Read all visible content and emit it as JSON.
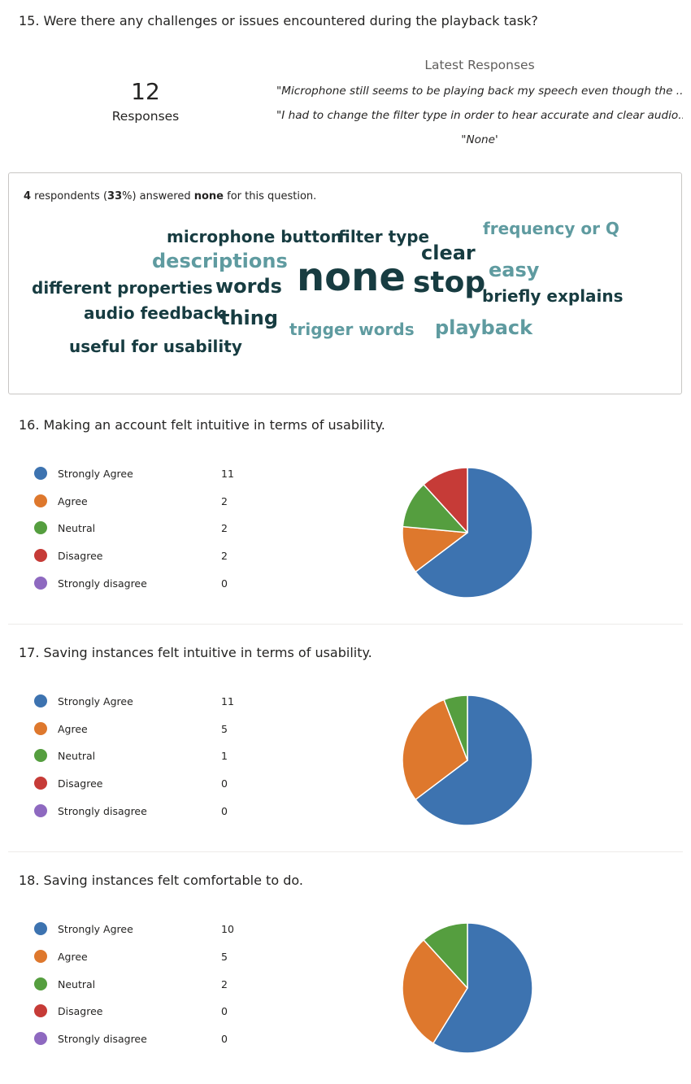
{
  "q15": {
    "title": "15.  Were there any challenges or issues encountered during the playback task?",
    "responses_count": "12",
    "responses_label": "Responses",
    "latest_title": "Latest Responses",
    "latest": [
      "\"Microphone still seems to be playing back my speech even though the ...",
      "\"I had to change the filter type in order to hear accurate and clear audio...",
      "\"None'"
    ],
    "summary": {
      "count": "4",
      "text1": " respondents (",
      "pct": "33",
      "text2": "%) answered ",
      "keyword": "none",
      "text3": " for this question."
    },
    "words": [
      {
        "text": "microphone button",
        "tone": "dark"
      },
      {
        "text": "filter type",
        "tone": "dark"
      },
      {
        "text": "frequency or Q",
        "tone": "light"
      },
      {
        "text": "clear",
        "tone": "dark"
      },
      {
        "text": "descriptions",
        "tone": "light"
      },
      {
        "text": "easy",
        "tone": "light"
      },
      {
        "text": "different properties",
        "tone": "dark"
      },
      {
        "text": "words",
        "tone": "dark"
      },
      {
        "text": "none",
        "tone": "dark"
      },
      {
        "text": "stop",
        "tone": "dark"
      },
      {
        "text": "briefly explains",
        "tone": "dark"
      },
      {
        "text": "audio feedback",
        "tone": "dark"
      },
      {
        "text": "thing",
        "tone": "dark"
      },
      {
        "text": "trigger words",
        "tone": "light"
      },
      {
        "text": "playback",
        "tone": "light"
      },
      {
        "text": "useful for usability",
        "tone": "dark"
      }
    ]
  },
  "colors": {
    "Strongly Agree": "#3d73b0",
    "Agree": "#de782d",
    "Neutral": "#559e3f",
    "Disagree": "#c63b37",
    "Strongly disagree": "#8e69c0",
    "word_dark": "#173c41",
    "word_light": "#5f9ba0"
  },
  "q16": {
    "title": "16.  Making an account felt intuitive in terms of usability.",
    "options": [
      {
        "label": "Strongly Agree",
        "value": "11"
      },
      {
        "label": "Agree",
        "value": "2"
      },
      {
        "label": "Neutral",
        "value": "2"
      },
      {
        "label": "Disagree",
        "value": "2"
      },
      {
        "label": "Strongly disagree",
        "value": "0"
      }
    ]
  },
  "q17": {
    "title": "17.  Saving instances felt intuitive in terms of usability.",
    "options": [
      {
        "label": "Strongly Agree",
        "value": "11"
      },
      {
        "label": "Agree",
        "value": "5"
      },
      {
        "label": "Neutral",
        "value": "1"
      },
      {
        "label": "Disagree",
        "value": "0"
      },
      {
        "label": "Strongly disagree",
        "value": "0"
      }
    ]
  },
  "q18": {
    "title": "18.  Saving instances felt comfortable to do.",
    "options": [
      {
        "label": "Strongly Agree",
        "value": "10"
      },
      {
        "label": "Agree",
        "value": "5"
      },
      {
        "label": "Neutral",
        "value": "2"
      },
      {
        "label": "Disagree",
        "value": "0"
      },
      {
        "label": "Strongly disagree",
        "value": "0"
      }
    ]
  }
}
